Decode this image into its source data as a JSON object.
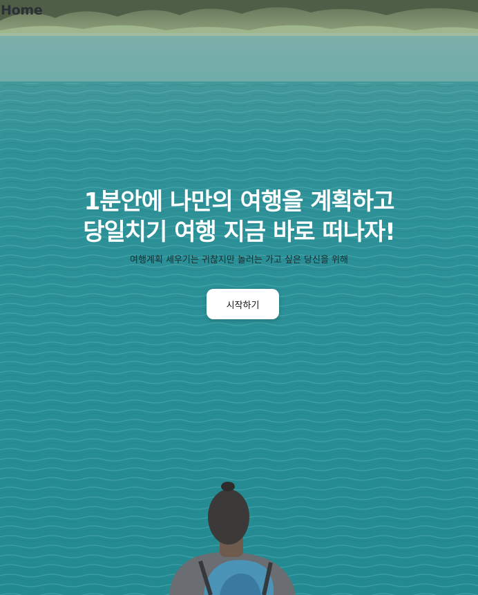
{
  "nav": {
    "home_label": "Home"
  },
  "hero": {
    "title_line1": "1분안에 나만의 여행을 계획하고",
    "title_line2": "당일치기 여행 지금 바로 떠나자!",
    "subtitle": "여행계획 세우기는 귀찮지만 놀러는 가고 싶은 당신을 위해",
    "cta_label": "시작하기"
  },
  "colors": {
    "water": "#2c9199",
    "title_text": "#ffffff",
    "nav_text": "#2b2f36",
    "button_bg": "#ffffff"
  },
  "background": {
    "icon": "lake-hiker-photo"
  }
}
